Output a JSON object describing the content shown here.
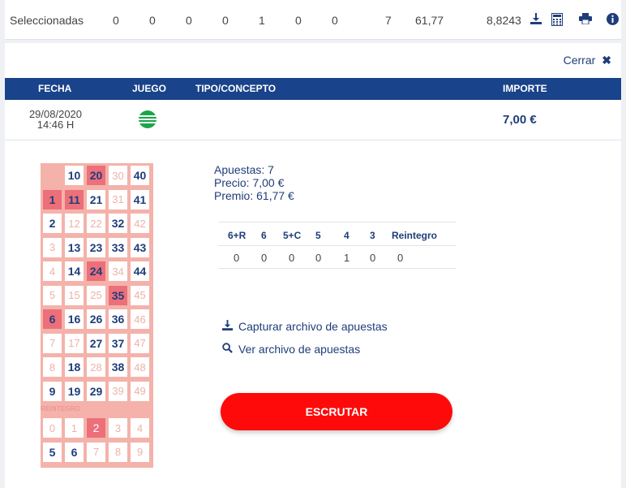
{
  "summary": {
    "label": "Seleccionadas",
    "values": [
      "0",
      "0",
      "0",
      "0",
      "1",
      "0",
      "0",
      "7",
      "61,77",
      "8,8243"
    ],
    "icons": [
      "download-icon",
      "calculator-icon",
      "print-icon",
      "info-icon"
    ]
  },
  "detail": {
    "close_label": "Cerrar",
    "columns": {
      "fecha": "FECHA",
      "juego": "JUEGO",
      "tipo": "TIPO/CONCEPTO",
      "importe": "IMPORTE"
    },
    "row": {
      "date": "29/08/2020",
      "time": "14:46 H",
      "game_icon": "lottery-ball-icon",
      "amount": "7,00 €"
    }
  },
  "ticket": {
    "rows": [
      [
        {
          "v": "",
          "t": "empty"
        },
        {
          "v": "10",
          "t": "n"
        },
        {
          "v": "20",
          "t": "hit"
        },
        {
          "v": "30",
          "t": "faint"
        },
        {
          "v": "40",
          "t": "n"
        }
      ],
      [
        {
          "v": "1",
          "t": "hit"
        },
        {
          "v": "11",
          "t": "hit"
        },
        {
          "v": "21",
          "t": "n"
        },
        {
          "v": "31",
          "t": "faint"
        },
        {
          "v": "41",
          "t": "n"
        }
      ],
      [
        {
          "v": "2",
          "t": "n"
        },
        {
          "v": "12",
          "t": "faint"
        },
        {
          "v": "22",
          "t": "faint"
        },
        {
          "v": "32",
          "t": "n"
        },
        {
          "v": "42",
          "t": "faint"
        }
      ],
      [
        {
          "v": "3",
          "t": "faint"
        },
        {
          "v": "13",
          "t": "n"
        },
        {
          "v": "23",
          "t": "n"
        },
        {
          "v": "33",
          "t": "n"
        },
        {
          "v": "43",
          "t": "n"
        }
      ],
      [
        {
          "v": "4",
          "t": "faint"
        },
        {
          "v": "14",
          "t": "n"
        },
        {
          "v": "24",
          "t": "hit"
        },
        {
          "v": "34",
          "t": "faint"
        },
        {
          "v": "44",
          "t": "n"
        }
      ],
      [
        {
          "v": "5",
          "t": "faint"
        },
        {
          "v": "15",
          "t": "faint"
        },
        {
          "v": "25",
          "t": "faint"
        },
        {
          "v": "35",
          "t": "hit"
        },
        {
          "v": "45",
          "t": "faint"
        }
      ],
      [
        {
          "v": "6",
          "t": "hit"
        },
        {
          "v": "16",
          "t": "n"
        },
        {
          "v": "26",
          "t": "n"
        },
        {
          "v": "36",
          "t": "n"
        },
        {
          "v": "46",
          "t": "faint"
        }
      ],
      [
        {
          "v": "7",
          "t": "faint"
        },
        {
          "v": "17",
          "t": "faint"
        },
        {
          "v": "27",
          "t": "n"
        },
        {
          "v": "37",
          "t": "n"
        },
        {
          "v": "47",
          "t": "faint"
        }
      ],
      [
        {
          "v": "8",
          "t": "faint"
        },
        {
          "v": "18",
          "t": "n"
        },
        {
          "v": "28",
          "t": "faint"
        },
        {
          "v": "38",
          "t": "n"
        },
        {
          "v": "48",
          "t": "faint"
        }
      ],
      [
        {
          "v": "9",
          "t": "n"
        },
        {
          "v": "19",
          "t": "n"
        },
        {
          "v": "29",
          "t": "n"
        },
        {
          "v": "39",
          "t": "faint"
        },
        {
          "v": "49",
          "t": "faint"
        }
      ]
    ],
    "reintegro_label": "REINTEGRO",
    "reintegro_rows": [
      [
        {
          "v": "0",
          "t": "faint"
        },
        {
          "v": "1",
          "t": "faint"
        },
        {
          "v": "2",
          "t": "hit-faint"
        },
        {
          "v": "3",
          "t": "faint"
        },
        {
          "v": "4",
          "t": "faint"
        }
      ],
      [
        {
          "v": "5",
          "t": "n"
        },
        {
          "v": "6",
          "t": "n"
        },
        {
          "v": "7",
          "t": "faint"
        },
        {
          "v": "8",
          "t": "faint"
        },
        {
          "v": "9",
          "t": "faint"
        }
      ]
    ]
  },
  "stats": {
    "apuestas": "Apuestas: 7",
    "precio": "Precio: 7,00 €",
    "premio": "Premio: 61,77 €"
  },
  "prize_table": {
    "headers": [
      "6+R",
      "6",
      "5+C",
      "5",
      "4",
      "3",
      "Reintegro"
    ],
    "values": [
      "0",
      "0",
      "0",
      "0",
      "1",
      "0",
      "0"
    ]
  },
  "actions": {
    "capture": "Capturar archivo de apuestas",
    "view": "Ver archivo de apuestas",
    "scrutar": "ESCRUTAR"
  }
}
